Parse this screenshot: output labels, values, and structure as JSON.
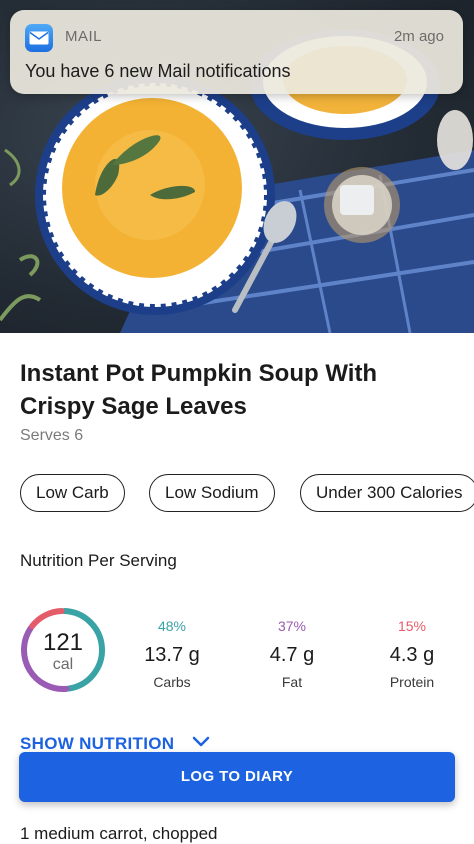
{
  "notification": {
    "app": "MAIL",
    "time": "2m ago",
    "message": "You have 6 new Mail notifications",
    "icon": "mail-envelope-icon"
  },
  "recipe": {
    "title": "Instant Pot Pumpkin Soup With Crispy Sage Leaves",
    "serves": "Serves 6",
    "tags": [
      "Low Carb",
      "Low Sodium",
      "Under 300 Calories"
    ]
  },
  "nutrition": {
    "section_label": "Nutrition Per Serving",
    "calories_value": "121",
    "calories_unit": "cal",
    "macros": [
      {
        "pct": "48%",
        "grams": "13.7 g",
        "label": "Carbs",
        "color": "#3aa3a6"
      },
      {
        "pct": "37%",
        "grams": "4.7 g",
        "label": "Fat",
        "color": "#9a5bb5"
      },
      {
        "pct": "15%",
        "grams": "4.3 g",
        "label": "Protein",
        "color": "#e45b6a"
      }
    ]
  },
  "actions": {
    "show_nutrition": "SHOW NUTRITION",
    "log_to_diary": "LOG TO DIARY"
  },
  "ingredients": {
    "first": "1 medium carrot, chopped"
  },
  "colors": {
    "accent": "#1d62e0",
    "carbs": "#3aa3a6",
    "fat": "#9a5bb5",
    "protein": "#e45b6a"
  }
}
